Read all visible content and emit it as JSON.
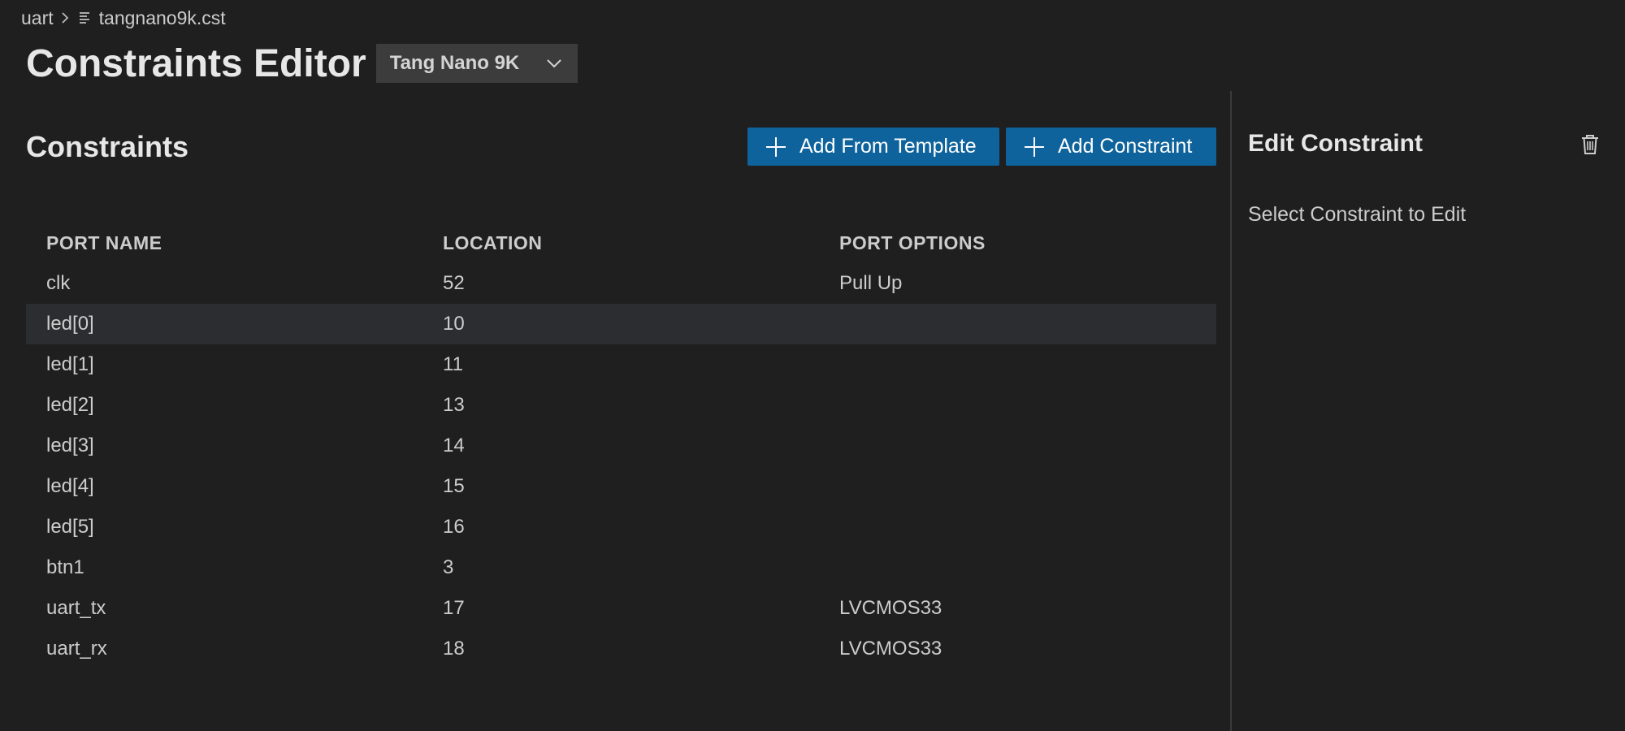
{
  "breadcrumb": {
    "folder": "uart",
    "file": "tangnano9k.cst"
  },
  "header": {
    "title": "Constraints Editor",
    "board_select": "Tang Nano 9K"
  },
  "constraints": {
    "title": "Constraints",
    "add_template_label": "Add From Template",
    "add_constraint_label": "Add Constraint",
    "columns": [
      "PORT NAME",
      "LOCATION",
      "PORT OPTIONS"
    ],
    "rows": [
      {
        "port": "clk",
        "location": "52",
        "options": "Pull Up"
      },
      {
        "port": "led[0]",
        "location": "10",
        "options": "",
        "selected": true
      },
      {
        "port": "led[1]",
        "location": "11",
        "options": ""
      },
      {
        "port": "led[2]",
        "location": "13",
        "options": ""
      },
      {
        "port": "led[3]",
        "location": "14",
        "options": ""
      },
      {
        "port": "led[4]",
        "location": "15",
        "options": ""
      },
      {
        "port": "led[5]",
        "location": "16",
        "options": ""
      },
      {
        "port": "btn1",
        "location": "3",
        "options": ""
      },
      {
        "port": "uart_tx",
        "location": "17",
        "options": "LVCMOS33"
      },
      {
        "port": "uart_rx",
        "location": "18",
        "options": "LVCMOS33"
      }
    ]
  },
  "edit_panel": {
    "title": "Edit Constraint",
    "empty_message": "Select Constraint to Edit"
  },
  "colors": {
    "background": "#1f1f1f",
    "button": "#0e639c",
    "selected_row": "#2b2d30",
    "select_bg": "#3c3c3c"
  },
  "icons": {
    "breadcrumb_separator": "chevron-right-icon",
    "file": "file-lines-icon",
    "dropdown": "chevron-down-icon",
    "add": "plus-icon",
    "delete": "trash-icon"
  }
}
